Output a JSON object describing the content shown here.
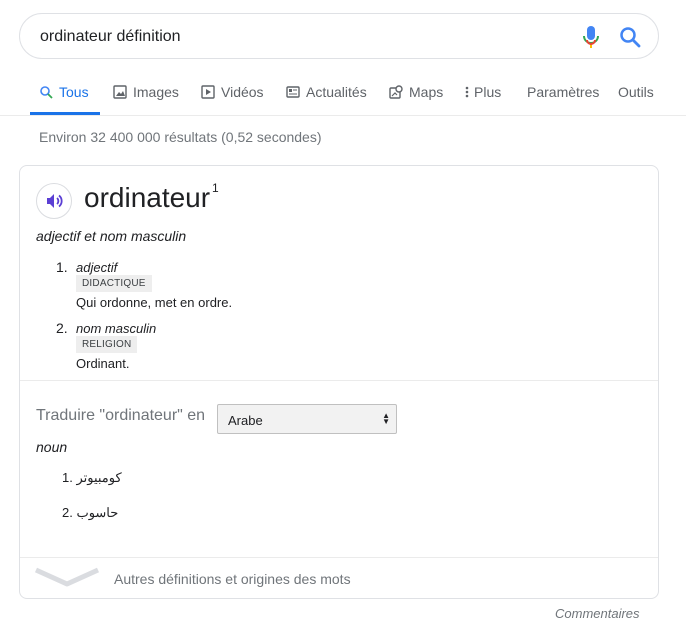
{
  "search": {
    "query": "ordinateur définition"
  },
  "tabs": [
    {
      "label": "Tous",
      "icon": "search-icon",
      "active": true
    },
    {
      "label": "Images",
      "icon": "image-icon"
    },
    {
      "label": "Vidéos",
      "icon": "video-icon"
    },
    {
      "label": "Actualités",
      "icon": "news-icon"
    },
    {
      "label": "Maps",
      "icon": "map-icon"
    },
    {
      "label": "Plus",
      "icon": "more-vert-icon"
    },
    {
      "label": "Paramètres"
    },
    {
      "label": "Outils"
    }
  ],
  "stats": "Environ 32 400 000 résultats (0,52 secondes)",
  "dictionary": {
    "word": "ordinateur",
    "superscript": "1",
    "part_of_speech": "adjectif et nom masculin",
    "definitions": [
      {
        "num": "1.",
        "type": "adjectif",
        "tag": "DIDACTIQUE",
        "text": "Qui ordonne, met en ordre."
      },
      {
        "num": "2.",
        "type": "nom masculin",
        "tag": "RELIGION",
        "text": "Ordinant."
      }
    ]
  },
  "translation": {
    "label": "Traduire \"ordinateur\" en",
    "language": "Arabe",
    "pos": "noun",
    "items": [
      "كومبيوتر .1",
      "حاسوب .2"
    ]
  },
  "more_definitions_label": "Autres définitions et origines des mots",
  "feedback_label": "Commentaires",
  "colors": {
    "accent": "#1a73e8",
    "muted": "#70757a",
    "border": "#dfe1e5"
  }
}
